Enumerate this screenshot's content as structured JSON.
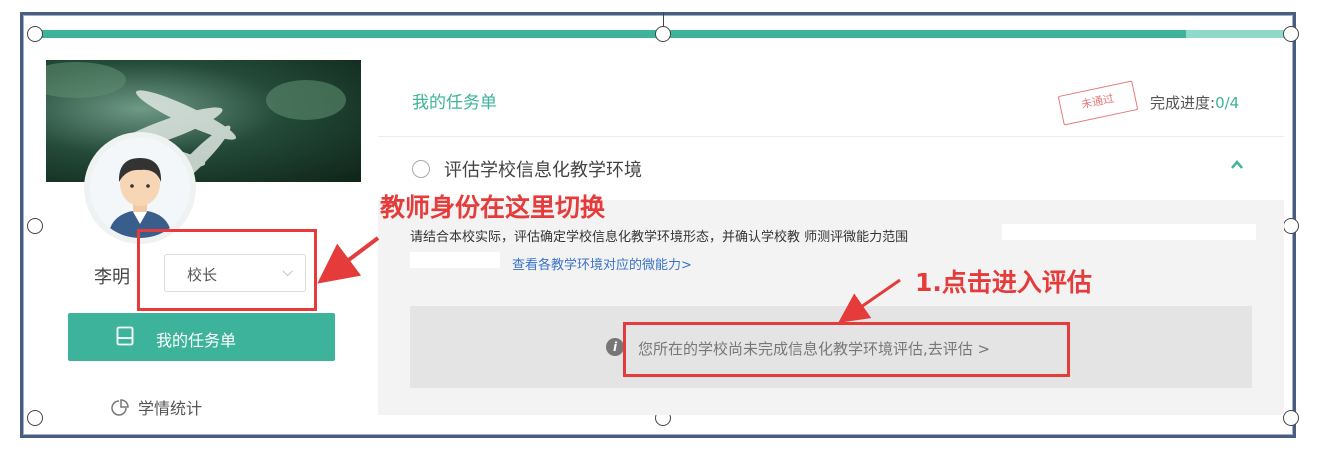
{
  "user": {
    "name": "李明",
    "role": "校长"
  },
  "sidebar": {
    "task_button_label": "我的任务单",
    "stats_label": "学情统计"
  },
  "main": {
    "title": "我的任务单",
    "stamp": "未通过",
    "progress_label": "完成进度:",
    "progress_value": "0/4",
    "task": {
      "title": "评估学校信息化教学环境",
      "description": "请结合本校实际，评估确定学校信息化教学环境形态，并确认学校教 师测评微能力范围",
      "link": "查看各教学环境对应的微能力>",
      "notice": "您所在的学校尚未完成信息化教学环境评估,去评估 >"
    }
  },
  "annotations": {
    "switch_identity": "教师身份在这里切换",
    "step1": "1.点击进入评估"
  },
  "colors": {
    "accent": "#3cb39a",
    "annotation": "#e53b3b",
    "link": "#3a73c7"
  },
  "icons": [
    "clipboard-icon",
    "pie-chart-icon",
    "info-icon",
    "chevron-down-icon",
    "chevron-up-icon"
  ]
}
